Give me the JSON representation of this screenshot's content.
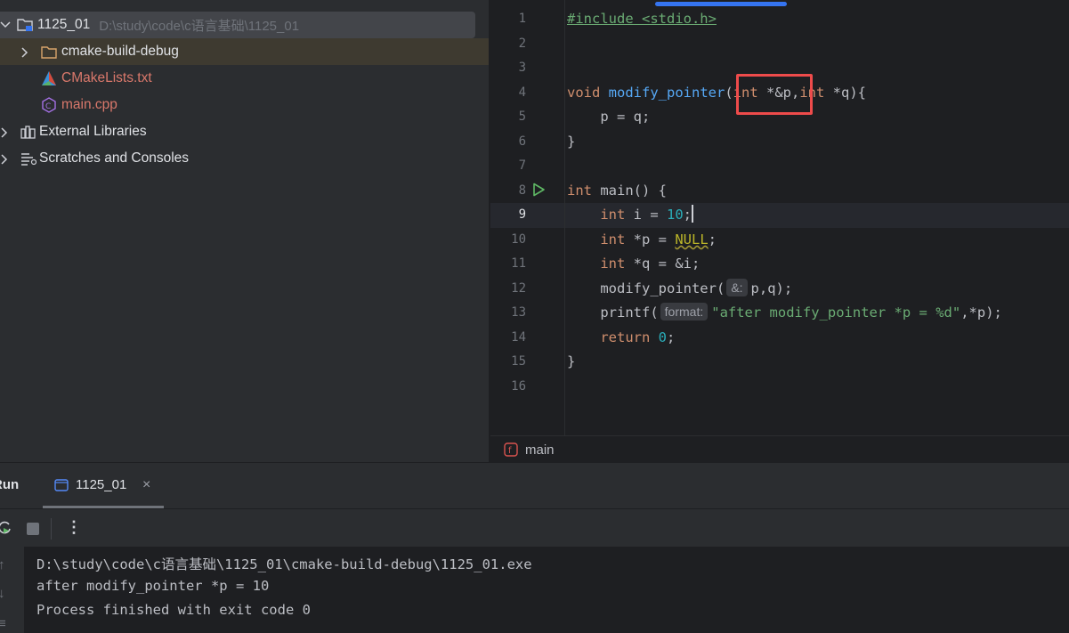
{
  "project_tree": {
    "root": {
      "name": "1125_01",
      "path": "D:\\study\\code\\c语言基础\\1125_01"
    },
    "items": [
      {
        "label": "cmake-build-debug",
        "icon": "folder-icon"
      },
      {
        "label": "CMakeLists.txt",
        "icon": "cmake-icon"
      },
      {
        "label": "main.cpp",
        "icon": "cpp-file-icon"
      },
      {
        "label": "External Libraries",
        "icon": "libraries-icon"
      },
      {
        "label": "Scratches and Consoles",
        "icon": "scratches-icon"
      }
    ]
  },
  "editor": {
    "line_numbers": [
      "1",
      "2",
      "3",
      "4",
      "5",
      "6",
      "7",
      "8",
      "9",
      "10",
      "11",
      "12",
      "13",
      "14",
      "15",
      "16"
    ],
    "current_line": "9",
    "code": {
      "l1": "#include <stdio.h>",
      "l4_void": "void",
      "l4_fn": "modify_pointer",
      "l4_rest_a": "(",
      "l4_int1": "int",
      "l4_p": " *&p,",
      "l4_int2": "int",
      "l4_q": " *q){",
      "l5": "    p = q;",
      "l6": "}",
      "l8_int": "int",
      "l8_main": " main() {",
      "l9_int": "int",
      "l9_mid": " i = ",
      "l9_num": "10",
      "l9_end": ";",
      "l10_int": "int",
      "l10_mid": " *p = ",
      "l10_null": "NULL",
      "l10_end": ";",
      "l11_int": "int",
      "l11_mid": " *q = &i;",
      "l12_a": "modify_pointer(",
      "l12_hint": "&:",
      "l12_b": "p,q);",
      "l13_a": "printf(",
      "l13_hint": "format:",
      "l13_str": "\"after modify_pointer *p = %d\"",
      "l13_b": ",*p);",
      "l14_kw": "return",
      "l14_num": " 0",
      "l14_end": ";",
      "l15": "}"
    },
    "breadcrumb": {
      "icon": "function-icon",
      "label": "main"
    }
  },
  "run_panel": {
    "title": "Run",
    "tab_label": "1125_01",
    "console": [
      "D:\\study\\code\\c语言基础\\1125_01\\cmake-build-debug\\1125_01.exe",
      "after modify_pointer *p = 10",
      "Process finished with exit code 0"
    ]
  },
  "colors": {
    "accent": "#3574f0",
    "highlight_box": "#ee4b4b",
    "run_green": "#5fb865"
  }
}
